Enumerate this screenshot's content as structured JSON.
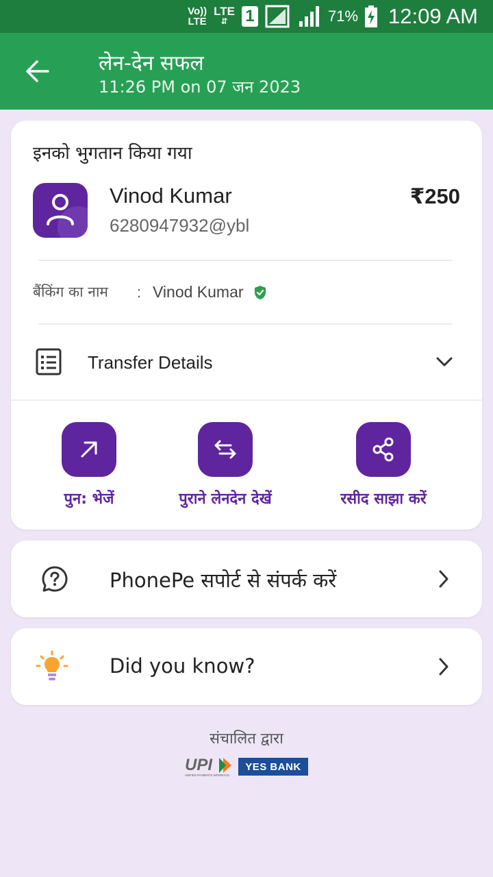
{
  "status_bar": {
    "volte": "Vo))",
    "volte_lte": "LTE",
    "network": "LTE",
    "sim": "1",
    "battery_percent": "71%",
    "time": "12:09 AM"
  },
  "header": {
    "title": "लेन-देन सफल",
    "subtitle": "11:26 PM on 07 जन 2023",
    "accent_color": "#27A055"
  },
  "payment": {
    "paid_to_label": "इनको भुगतान किया गया",
    "payee_name": "Vinod Kumar",
    "payee_upi": "6280947932@ybl",
    "amount": "₹250",
    "banking_name_label": "बैंकिंग का नाम",
    "banking_name_colon": ":",
    "banking_name_value": "Vinod Kumar",
    "transfer_details_label": "Transfer Details",
    "brand_color": "#5F259F"
  },
  "actions": [
    {
      "label": "पुन: भेजें",
      "icon": "arrow-up-right-icon"
    },
    {
      "label": "पुराने लेनदेन देखें",
      "icon": "swap-arrows-icon"
    },
    {
      "label": "रसीद साझा करें",
      "icon": "share-icon"
    }
  ],
  "support": {
    "label": "PhonePe सपोर्ट से संपर्क करें",
    "icon": "help-circle-icon"
  },
  "tips": {
    "label": "Did you know?",
    "icon": "lightbulb-icon"
  },
  "footer": {
    "powered_by": "संचालित द्वारा",
    "upi_logo_text": "UPI",
    "upi_logo_tagline": "UNIFIED PAYMENTS INTERFACE",
    "bank_logo_text": "YES BANK"
  }
}
